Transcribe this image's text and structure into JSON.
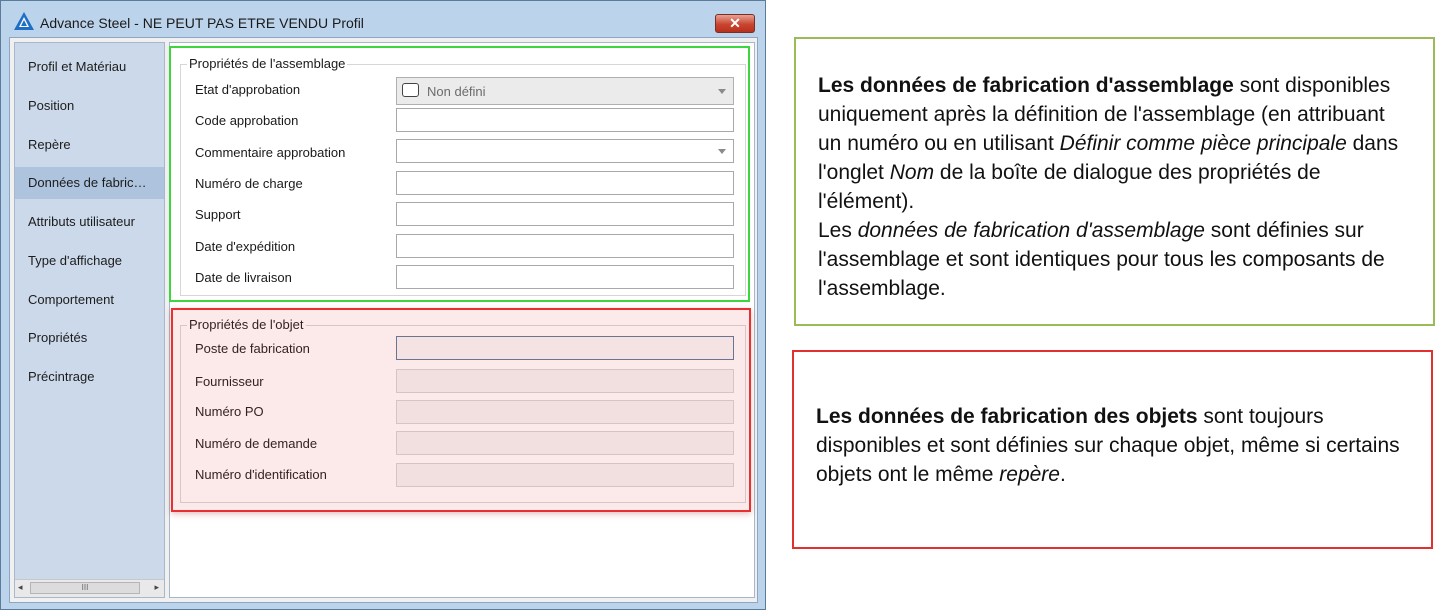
{
  "window": {
    "title": "Advance Steel - NE PEUT PAS ETRE VENDU   Profil",
    "close_glyph": "✕",
    "icon": "advance-steel-logo-icon"
  },
  "nav": {
    "items": [
      {
        "label": "Profil et Matériau"
      },
      {
        "label": "Position"
      },
      {
        "label": "Repère"
      },
      {
        "label": "Données de fabric…",
        "selected": true
      },
      {
        "label": "Attributs utilisateur"
      },
      {
        "label": "Type d'affichage"
      },
      {
        "label": "Comportement"
      },
      {
        "label": "Propriétés"
      },
      {
        "label": "Précintrage"
      }
    ],
    "scroll_left": "◂",
    "scroll_right": "▸",
    "scroll_grip": "III"
  },
  "assembly_group": {
    "title": "Propriétés de l'assemblage",
    "fields": [
      {
        "label": "Etat d'approbation",
        "value": "Non défini",
        "type": "combo-check"
      },
      {
        "label": "Code approbation",
        "value": "",
        "type": "text"
      },
      {
        "label": "Commentaire approbation",
        "value": "",
        "type": "dropdown"
      },
      {
        "label": "Numéro de charge",
        "value": "",
        "type": "text"
      },
      {
        "label": "Support",
        "value": "",
        "type": "text"
      },
      {
        "label": "Date d'expédition",
        "value": "",
        "type": "text"
      },
      {
        "label": "Date de livraison",
        "value": "",
        "type": "text"
      }
    ]
  },
  "object_group": {
    "title": "Propriétés de l'objet",
    "fields": [
      {
        "label": "Poste de fabrication",
        "value": ""
      },
      {
        "label": "Fournisseur",
        "value": ""
      },
      {
        "label": "Numéro PO",
        "value": ""
      },
      {
        "label": "Numéro de demande",
        "value": ""
      },
      {
        "label": "Numéro d'identification",
        "value": ""
      }
    ]
  },
  "callout_assembly": {
    "p1_bold": "Les données de fabrication d'assemblage",
    "p1_a": " sont disponibles uniquement après la définition de l'assemblage (en attribuant un numéro ou en utilisant ",
    "p1_italic": "Définir comme pièce principale",
    "p1_b": " dans l'onglet ",
    "p1_italic2": "Nom",
    "p1_c": " de la boîte de dialogue des propriétés de l'élément).",
    "p2_a": "Les ",
    "p2_italic": "données de fabrication d'assemblage",
    "p2_b": " sont définies sur l'assemblage et sont identiques pour tous les composants de l'assemblage."
  },
  "callout_objects": {
    "bold": "Les données de fabrication des objets",
    "a": " sont toujours disponibles et sont définies sur chaque objet, même si certains objets ont le même ",
    "italic": "repère",
    "b": "."
  },
  "colors": {
    "green_highlight": "#3ed63e",
    "red_highlight": "#e83030",
    "green_callout_border": "#9bbb59",
    "selected_nav": "#aec4de"
  }
}
